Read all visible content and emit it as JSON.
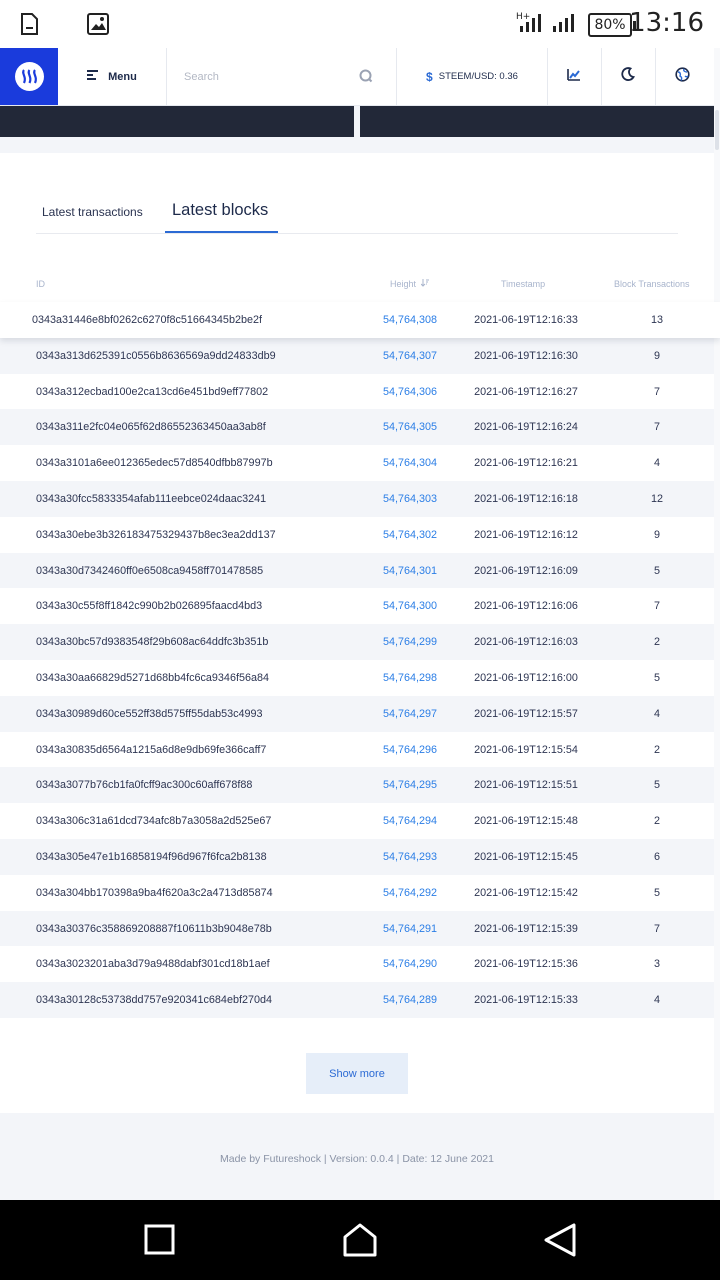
{
  "status_bar": {
    "time": "13:16",
    "battery": "80%",
    "icons": [
      "sim-card-icon",
      "image-icon",
      "signal-icon",
      "signal-icon",
      "battery-icon"
    ]
  },
  "header": {
    "menu_label": "Menu",
    "search_placeholder": "Search",
    "price_label": "STEEM/USD: 0.36",
    "icons": [
      "steem-logo-icon",
      "menu-icon",
      "search-icon",
      "dollar-icon",
      "chart-icon",
      "moon-icon",
      "globe-icon"
    ]
  },
  "tabs": [
    {
      "label": "Latest transactions",
      "active": false
    },
    {
      "label": "Latest blocks",
      "active": true
    }
  ],
  "table": {
    "headers": {
      "id": "ID",
      "height": "Height",
      "timestamp": "Timestamp",
      "transactions": "Block Transactions"
    },
    "rows": [
      {
        "id": "0343a31446e8bf0262c6270f8c51664345b2be2f",
        "height": "54,764,308",
        "timestamp": "2021-06-19T12:16:33",
        "transactions": "13"
      },
      {
        "id": "0343a313d625391c0556b8636569a9dd24833db9",
        "height": "54,764,307",
        "timestamp": "2021-06-19T12:16:30",
        "transactions": "9"
      },
      {
        "id": "0343a312ecbad100e2ca13cd6e451bd9eff77802",
        "height": "54,764,306",
        "timestamp": "2021-06-19T12:16:27",
        "transactions": "7"
      },
      {
        "id": "0343a311e2fc04e065f62d86552363450aa3ab8f",
        "height": "54,764,305",
        "timestamp": "2021-06-19T12:16:24",
        "transactions": "7"
      },
      {
        "id": "0343a3101a6ee012365edec57d8540dfbb87997b",
        "height": "54,764,304",
        "timestamp": "2021-06-19T12:16:21",
        "transactions": "4"
      },
      {
        "id": "0343a30fcc5833354afab111eebce024daac3241",
        "height": "54,764,303",
        "timestamp": "2021-06-19T12:16:18",
        "transactions": "12"
      },
      {
        "id": "0343a30ebe3b326183475329437b8ec3ea2dd137",
        "height": "54,764,302",
        "timestamp": "2021-06-19T12:16:12",
        "transactions": "9"
      },
      {
        "id": "0343a30d7342460ff0e6508ca9458ff701478585",
        "height": "54,764,301",
        "timestamp": "2021-06-19T12:16:09",
        "transactions": "5"
      },
      {
        "id": "0343a30c55f8ff1842c990b2b026895faacd4bd3",
        "height": "54,764,300",
        "timestamp": "2021-06-19T12:16:06",
        "transactions": "7"
      },
      {
        "id": "0343a30bc57d9383548f29b608ac64ddfc3b351b",
        "height": "54,764,299",
        "timestamp": "2021-06-19T12:16:03",
        "transactions": "2"
      },
      {
        "id": "0343a30aa66829d5271d68bb4fc6ca9346f56a84",
        "height": "54,764,298",
        "timestamp": "2021-06-19T12:16:00",
        "transactions": "5"
      },
      {
        "id": "0343a30989d60ce552ff38d575ff55dab53c4993",
        "height": "54,764,297",
        "timestamp": "2021-06-19T12:15:57",
        "transactions": "4"
      },
      {
        "id": "0343a30835d6564a1215a6d8e9db69fe366caff7",
        "height": "54,764,296",
        "timestamp": "2021-06-19T12:15:54",
        "transactions": "2"
      },
      {
        "id": "0343a3077b76cb1fa0fcff9ac300c60aff678f88",
        "height": "54,764,295",
        "timestamp": "2021-06-19T12:15:51",
        "transactions": "5"
      },
      {
        "id": "0343a306c31a61dcd734afc8b7a3058a2d525e67",
        "height": "54,764,294",
        "timestamp": "2021-06-19T12:15:48",
        "transactions": "2"
      },
      {
        "id": "0343a305e47e1b16858194f96d967f6fca2b8138",
        "height": "54,764,293",
        "timestamp": "2021-06-19T12:15:45",
        "transactions": "6"
      },
      {
        "id": "0343a304bb170398a9ba4f620a3c2a4713d85874",
        "height": "54,764,292",
        "timestamp": "2021-06-19T12:15:42",
        "transactions": "5"
      },
      {
        "id": "0343a30376c358869208887f10611b3b9048e78b",
        "height": "54,764,291",
        "timestamp": "2021-06-19T12:15:39",
        "transactions": "7"
      },
      {
        "id": "0343a3023201aba3d79a9488dabf301cd18b1aef",
        "height": "54,764,290",
        "timestamp": "2021-06-19T12:15:36",
        "transactions": "3"
      },
      {
        "id": "0343a30128c53738dd757e920341c684ebf270d4",
        "height": "54,764,289",
        "timestamp": "2021-06-19T12:15:33",
        "transactions": "4"
      }
    ]
  },
  "show_more_label": "Show more",
  "footer_text": "Made by Futureshock |  Version: 0.0.4 | Date: 12 June 2021",
  "nav_icons": [
    "recents-square-icon",
    "home-icon",
    "back-triangle-icon"
  ],
  "colors": {
    "brand": "#1a3bdc",
    "link": "#2b7ee6",
    "dark_card": "#222838"
  }
}
